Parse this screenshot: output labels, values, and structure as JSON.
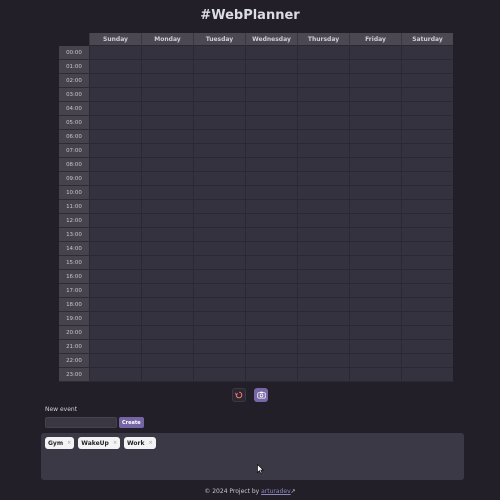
{
  "app": {
    "title": "#WebPlanner"
  },
  "planner": {
    "days": [
      "Sunday",
      "Monday",
      "Tuesday",
      "Wednesday",
      "Thursday",
      "Friday",
      "Saturday"
    ],
    "hours": [
      "00:00",
      "01:00",
      "02:00",
      "03:00",
      "04:00",
      "05:00",
      "06:00",
      "07:00",
      "08:00",
      "09:00",
      "10:00",
      "11:00",
      "12:00",
      "13:00",
      "14:00",
      "15:00",
      "16:00",
      "17:00",
      "18:00",
      "19:00",
      "20:00",
      "21:00",
      "22:00",
      "23:00"
    ]
  },
  "controls": {
    "reset_icon": "reset-icon",
    "screenshot_icon": "camera-icon",
    "colors": {
      "reset_bg": "#2b2830",
      "screenshot_bg": "#7767a6"
    }
  },
  "new_event": {
    "label": "New event",
    "input_value": "",
    "create_label": "Create"
  },
  "events": [
    {
      "label": "Gym",
      "remove": "×"
    },
    {
      "label": "WakeUp",
      "remove": "×"
    },
    {
      "label": "Work",
      "remove": "×"
    }
  ],
  "footer": {
    "text": "© 2024 Project by ",
    "link_text": "arturadev",
    "link_icon": "↗"
  },
  "colors": {
    "background": "#221f29",
    "cell": "#35323f",
    "accent": "#7565a5"
  }
}
